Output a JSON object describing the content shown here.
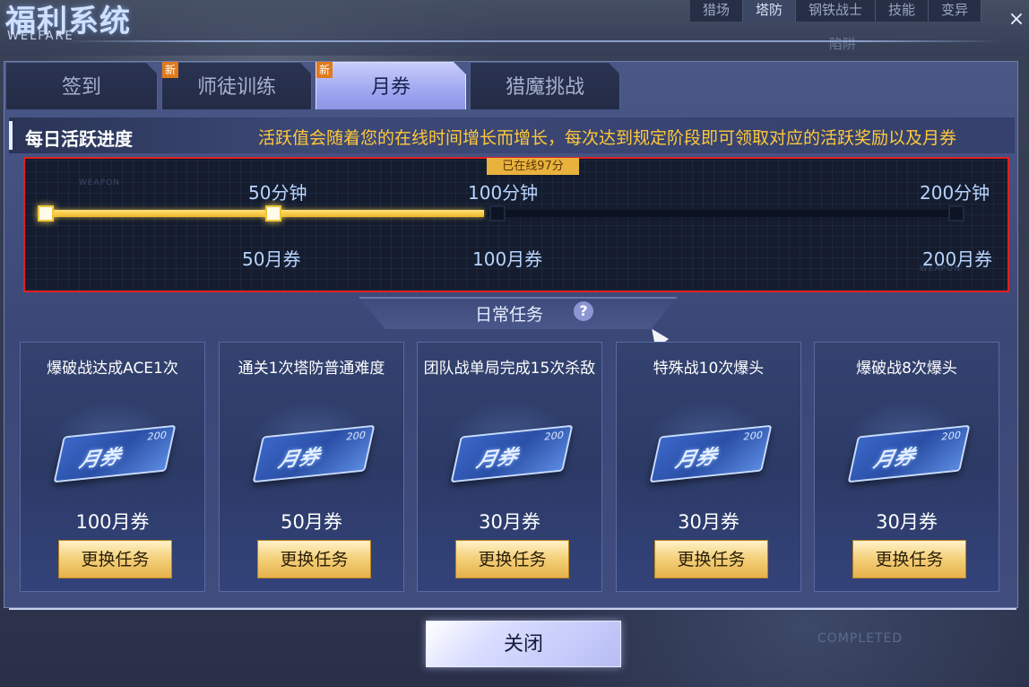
{
  "window": {
    "title": "福利系统",
    "subtitle": "WELFARE",
    "close_icon": "×"
  },
  "background_tabs": [
    "猎场",
    "塔防",
    "钢铁战士",
    "技能",
    "变异"
  ],
  "background_label": "陷阱",
  "background_completed": "COMPLETED",
  "tabs": [
    {
      "label": "签到",
      "new": false,
      "active": false
    },
    {
      "label": "师徒训练",
      "new": true,
      "active": false
    },
    {
      "label": "月券",
      "new": true,
      "active": true
    },
    {
      "label": "猎魔挑战",
      "new": false,
      "active": false
    }
  ],
  "new_badge": "新",
  "progress": {
    "title": "每日活跃进度",
    "description": "活跃值会随着您的在线时间增长而增长，每次达到规定阶段即可领取对应的活跃奖励以及月券",
    "online_label": "已在线97分",
    "online_minutes": 97,
    "max_minutes": 200,
    "weapon_mark": "WEAPON",
    "milestones": [
      {
        "time": "50分钟",
        "reward": "50月券",
        "reached": true
      },
      {
        "time": "100分钟",
        "reward": "100月券",
        "reached": false
      },
      {
        "time": "200分钟",
        "reward": "200月券",
        "reached": false
      }
    ]
  },
  "daily": {
    "title": "日常任务",
    "help_icon": "?"
  },
  "tasks": [
    {
      "name": "爆破战达成ACE1次",
      "reward": "100月券",
      "button": "更换任务"
    },
    {
      "name": "通关1次塔防普通难度",
      "reward": "50月券",
      "button": "更换任务"
    },
    {
      "name": "团队战单局完成15次杀敌",
      "reward": "30月券",
      "button": "更换任务"
    },
    {
      "name": "特殊战10次爆头",
      "reward": "30月券",
      "button": "更换任务"
    },
    {
      "name": "爆破战8次爆头",
      "reward": "30月券",
      "button": "更换任务"
    }
  ],
  "ticket": {
    "text": "月券",
    "number": "200"
  },
  "close_button": "关闭",
  "colors": {
    "accent_gold": "#ffc83a",
    "highlight_red": "#e02020",
    "milestone_blue": "#b8d4ff",
    "active_tab": "#9fa7f0"
  }
}
